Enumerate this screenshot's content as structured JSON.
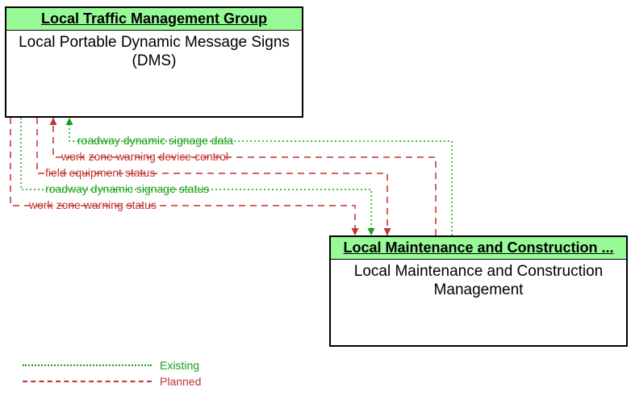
{
  "box1": {
    "header": "Local Traffic Management Group",
    "body": "Local Portable Dynamic Message Signs (DMS)"
  },
  "box2": {
    "header": "Local Maintenance and Construction ...",
    "body": "Local Maintenance and Construction Management"
  },
  "flows": {
    "f1": "roadway dynamic signage data",
    "f2": "work zone warning device control",
    "f3": "field equipment status",
    "f4": "roadway dynamic signage status",
    "f5": "work zone warning status"
  },
  "legend": {
    "existing": "Existing",
    "planned": "Planned"
  },
  "colors": {
    "existing": "#17a017",
    "planned": "#c23030",
    "header_bg": "#97fa97"
  }
}
